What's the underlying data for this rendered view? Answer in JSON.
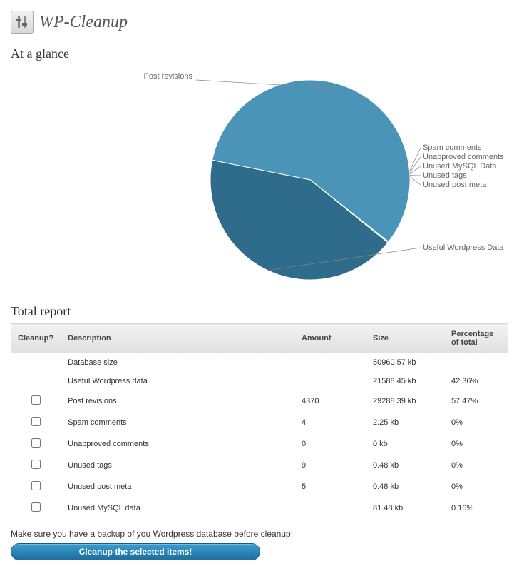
{
  "header": {
    "title": "WP-Cleanup"
  },
  "section_glance": {
    "heading": "At a glance"
  },
  "section_report": {
    "heading": "Total report",
    "columns": {
      "cleanup": "Cleanup?",
      "description": "Description",
      "amount": "Amount",
      "size": "Size",
      "percentage": "Percentage of total"
    },
    "rows": [
      {
        "checkbox": false,
        "description": "Database size",
        "amount": "",
        "size": "50960.57 kb",
        "percentage": ""
      },
      {
        "checkbox": false,
        "description": "Useful Wordpress data",
        "amount": "",
        "size": "21588.45 kb",
        "percentage": "42.36%"
      },
      {
        "checkbox": true,
        "description": "Post revisions",
        "amount": "4370",
        "size": "29288.39 kb",
        "percentage": "57.47%"
      },
      {
        "checkbox": true,
        "description": "Spam comments",
        "amount": "4",
        "size": "2.25 kb",
        "percentage": "0%"
      },
      {
        "checkbox": true,
        "description": "Unapproved comments",
        "amount": "0",
        "size": "0 kb",
        "percentage": "0%"
      },
      {
        "checkbox": true,
        "description": "Unused tags",
        "amount": "9",
        "size": "0.48 kb",
        "percentage": "0%"
      },
      {
        "checkbox": true,
        "description": "Unused post meta",
        "amount": "5",
        "size": "0.48 kb",
        "percentage": "0%"
      },
      {
        "checkbox": true,
        "description": "Unused MySQL data",
        "amount": "",
        "size": "81.48 kb",
        "percentage": "0.16%"
      }
    ]
  },
  "warning_text": "Make sure you have a backup of you Wordpress database before cleanup!",
  "button_label": "Cleanup the selected items!",
  "colors": {
    "pie_light": "#4a94b8",
    "pie_dark": "#2f6b8a",
    "pie_stroke": "#ffffff",
    "label_text": "#666"
  },
  "chart_data": {
    "type": "pie",
    "title": "",
    "slices": [
      {
        "name": "Post revisions",
        "value": 57.47,
        "size_kb": 29288.39
      },
      {
        "name": "Spam comments",
        "value": 0.004,
        "size_kb": 2.25
      },
      {
        "name": "Unapproved comments",
        "value": 0,
        "size_kb": 0
      },
      {
        "name": "Unused MySQL Data",
        "value": 0.16,
        "size_kb": 81.48
      },
      {
        "name": "Unused tags",
        "value": 0.001,
        "size_kb": 0.48
      },
      {
        "name": "Unused post meta",
        "value": 0.001,
        "size_kb": 0.48
      },
      {
        "name": "Useful Wordpress Data",
        "value": 42.36,
        "size_kb": 21588.45
      }
    ],
    "labels_left": [
      "Post revisions"
    ],
    "labels_right_top": [
      "Spam comments",
      "Unapproved comments",
      "Unused MySQL Data",
      "Unused tags",
      "Unused post meta"
    ],
    "labels_right_bottom": [
      "Useful Wordpress Data"
    ]
  }
}
